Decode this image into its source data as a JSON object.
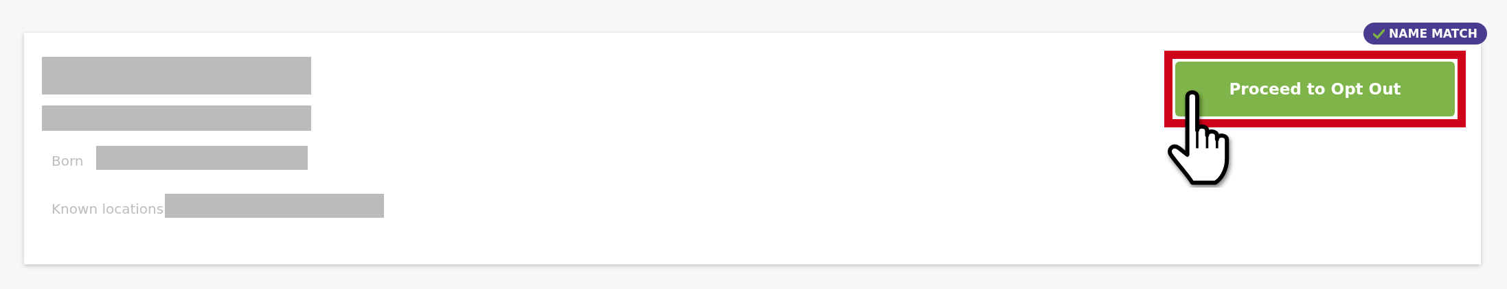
{
  "listing": {
    "name_redacted": true,
    "subtitle_redacted": true,
    "fields": [
      {
        "label": "Born",
        "redacted": true
      },
      {
        "label": "Known locations",
        "redacted": true
      }
    ],
    "badge": {
      "label": "NAME MATCH",
      "checked": true
    },
    "action": {
      "label": "Proceed to Opt Out",
      "highlighted": true
    },
    "cursor": {
      "kind": "pointer"
    }
  }
}
